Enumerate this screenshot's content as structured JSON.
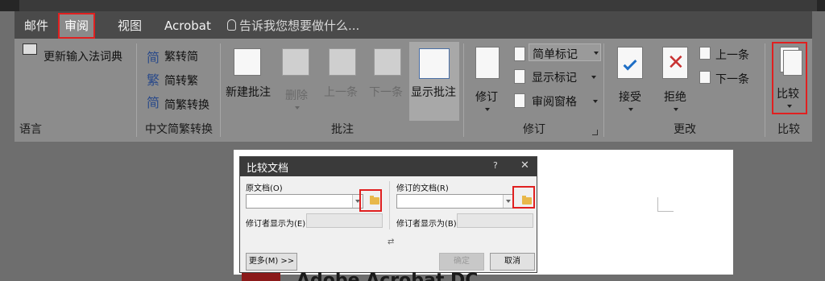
{
  "tabs": {
    "mail": "邮件",
    "review": "审阅",
    "view": "视图",
    "acrobat": "Acrobat",
    "tell_me": "告诉我您想要做什么..."
  },
  "ribbon": {
    "language": {
      "update_ime": "更新输入法词典",
      "label": "语言"
    },
    "chinese_conversion": {
      "trad_to_simp": "繁转简",
      "simp_to_trad": "简转繁",
      "conversion": "简繁转换",
      "label": "中文简繁转换"
    },
    "comments": {
      "new_comment": "新建批注",
      "delete": "删除",
      "previous": "上一条",
      "next": "下一条",
      "show_comments": "显示批注",
      "label": "批注"
    },
    "tracking": {
      "track_changes": "修订",
      "simple_markup": "简单标记",
      "show_markup": "显示标记",
      "reviewing_pane": "审阅窗格",
      "label": "修订"
    },
    "changes": {
      "accept": "接受",
      "reject": "拒绝",
      "previous": "上一条",
      "next": "下一条",
      "label": "更改"
    },
    "compare": {
      "compare": "比较",
      "label": "比较"
    }
  },
  "dialog": {
    "title": "比较文档",
    "help": "?",
    "close": "✕",
    "original_label": "原文档(O)",
    "revised_label": "修订的文档(R)",
    "label_changes_left": "修订者显示为(E)",
    "label_changes_right": "修订者显示为(B)",
    "more_button": "更多(M) >>",
    "ok_button": "确定",
    "cancel_button": "取消",
    "swap_icon": "⇄"
  },
  "background": {
    "title_text": "Adobe Acrobat DC"
  }
}
